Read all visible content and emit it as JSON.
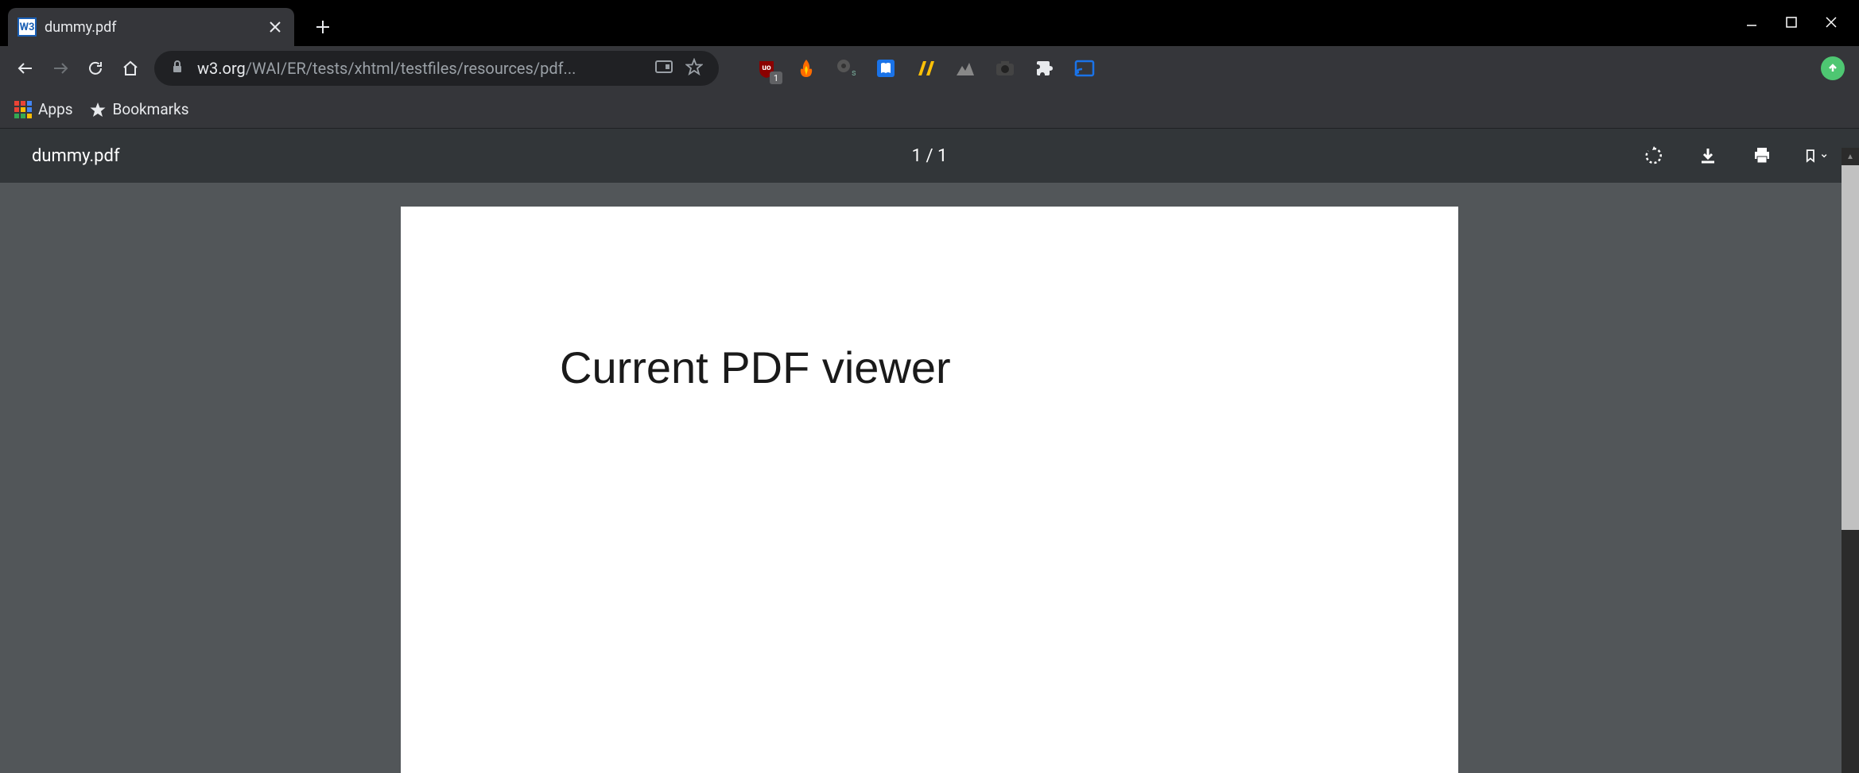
{
  "tab": {
    "favicon_text": "W3",
    "title": "dummy.pdf"
  },
  "url": {
    "domain": "w3.org",
    "path": "/WAI/ER/tests/xhtml/testfiles/resources/pdf..."
  },
  "bookmarks": {
    "apps_label": "Apps",
    "bookmarks_label": "Bookmarks"
  },
  "pdf_toolbar": {
    "filename": "dummy.pdf",
    "page_indicator": "1 / 1"
  },
  "pdf_content": {
    "heading": "Current PDF viewer"
  },
  "extension_ublock_badge": "1"
}
